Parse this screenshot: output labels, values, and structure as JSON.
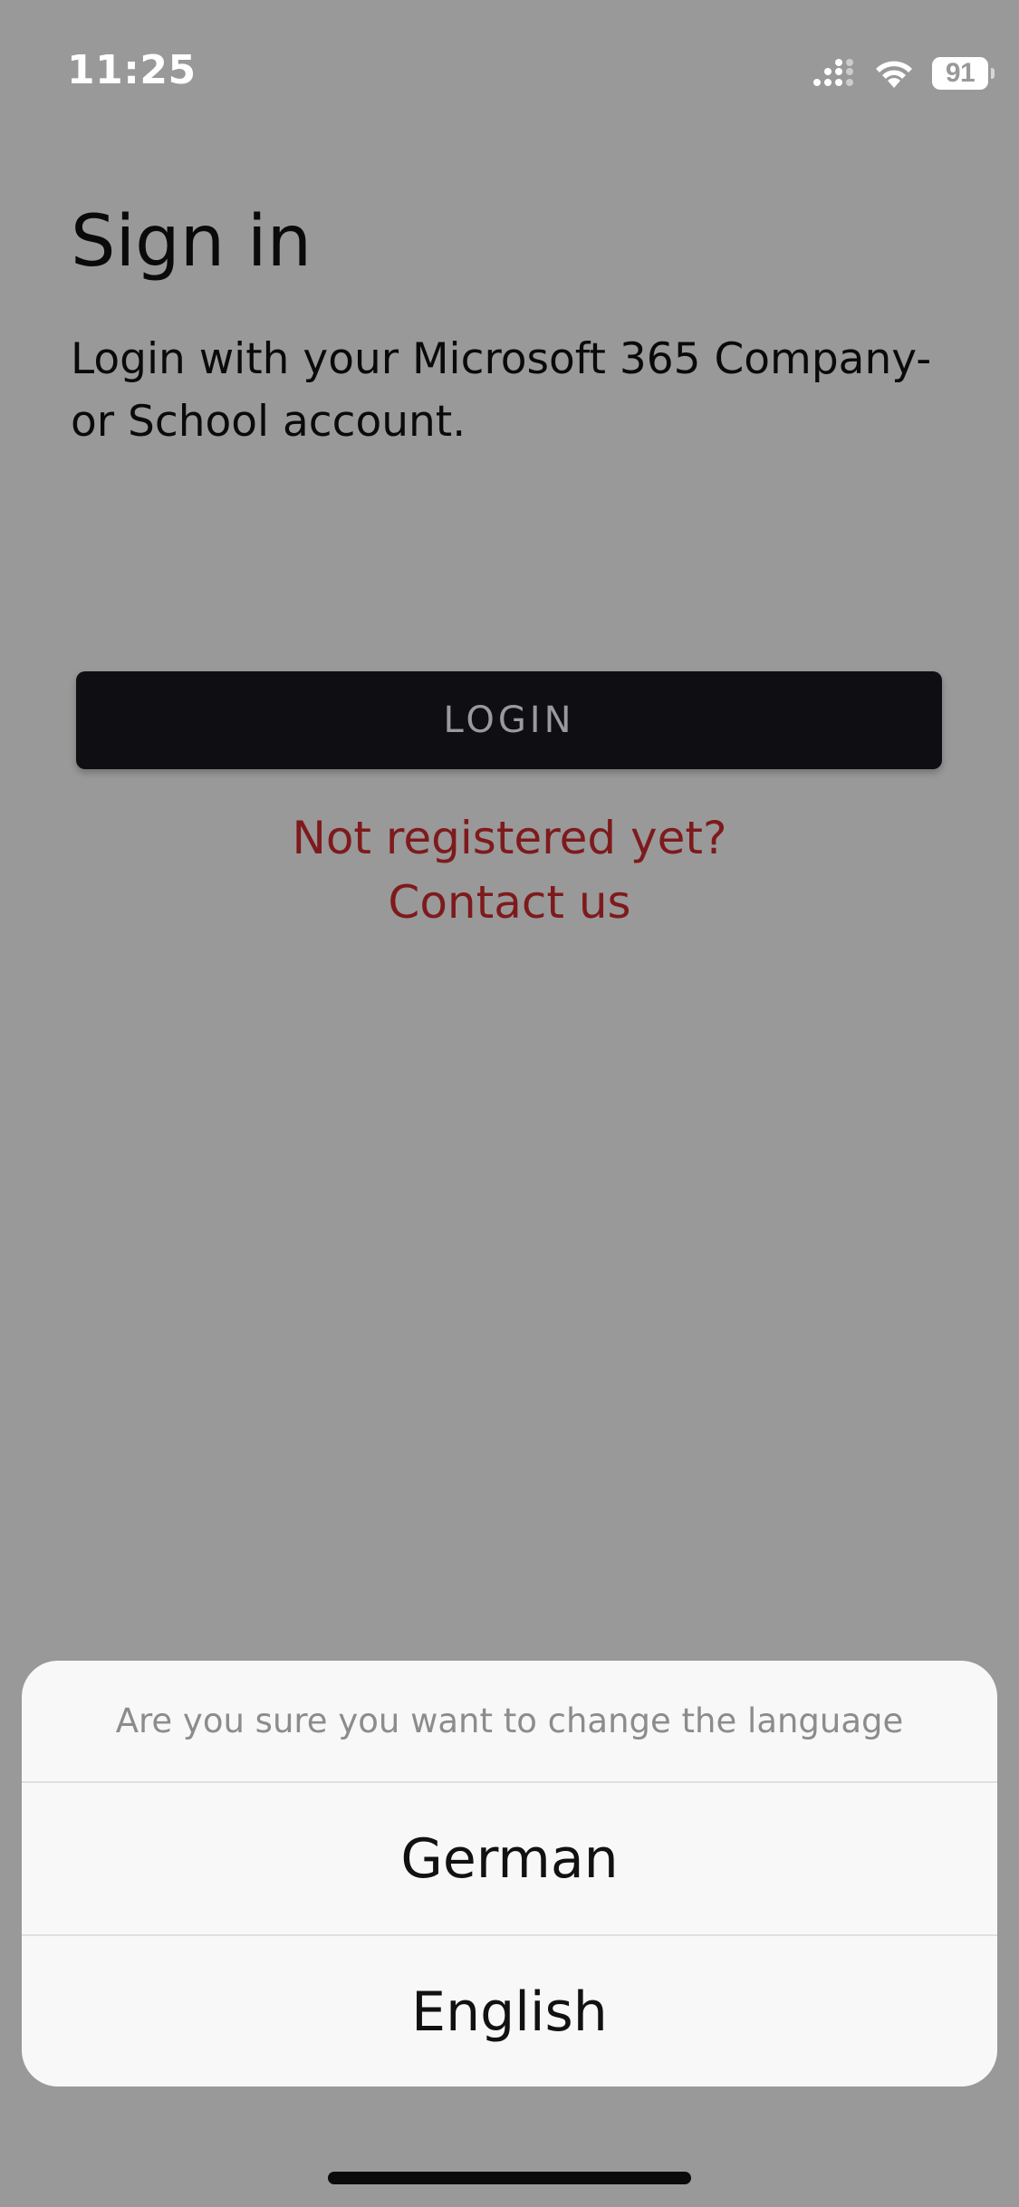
{
  "status_bar": {
    "time": "11:25",
    "battery_level": "91",
    "icons": [
      "signal-icon",
      "wifi-icon",
      "battery-icon"
    ]
  },
  "page": {
    "title": "Sign in",
    "subtitle": "Login with your Microsoft 365 Company- or School account."
  },
  "login_button": {
    "label": "LOGIN"
  },
  "register_link": {
    "line1": "Not registered yet?",
    "line2": "Contact us"
  },
  "action_sheet": {
    "message": "Are you sure you want to change the language",
    "options": [
      {
        "label": "German"
      },
      {
        "label": "English"
      }
    ]
  },
  "colors": {
    "background": "#999999",
    "button_bg": "#0f0e12",
    "link": "#7e1a1c",
    "sheet_bg": "#f8f8f8"
  }
}
